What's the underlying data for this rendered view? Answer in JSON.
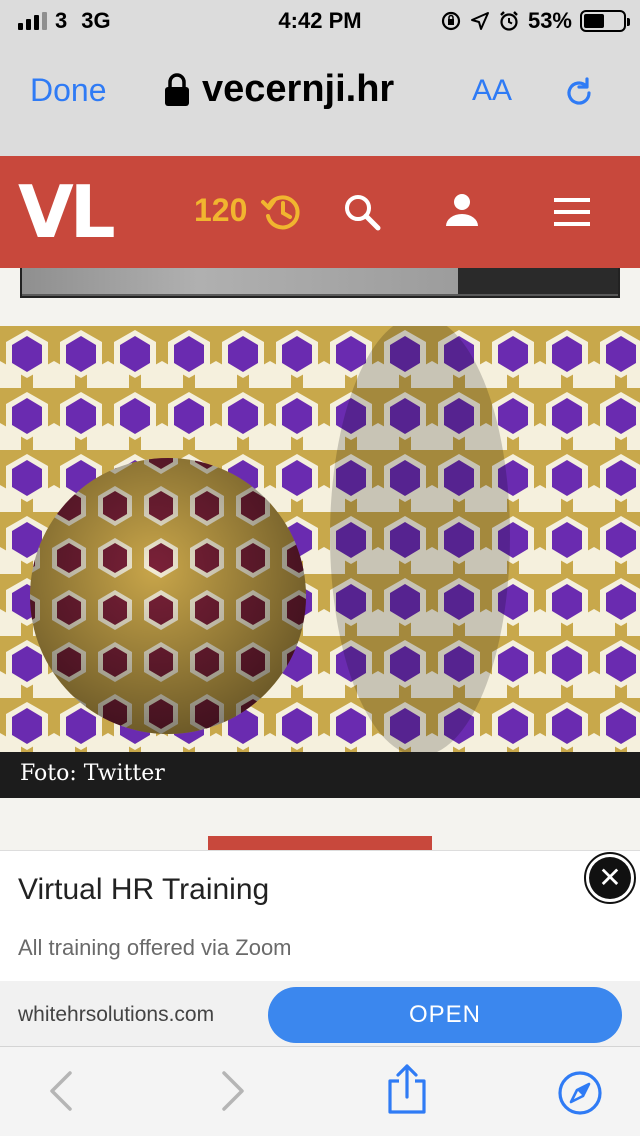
{
  "status_bar": {
    "carrier": "3",
    "network": "3G",
    "time": "4:42 PM",
    "battery": "53%",
    "battery_level": 0.53
  },
  "browser": {
    "done_label": "Done",
    "domain": "vecernji.hr",
    "text_size_label": "AA"
  },
  "site_header": {
    "logo": "VL",
    "history_count": "120",
    "accent": "#c8483c",
    "count_color": "#f1b52f"
  },
  "article": {
    "photo_caption": "Foto: Twitter"
  },
  "ad": {
    "title": "Virtual HR Training",
    "subtitle": "All training offered via Zoom",
    "url": "whitehrsolutions.com",
    "cta": "OPEN",
    "cta_color": "#3b87ee"
  },
  "icons": {
    "history": "history-icon",
    "search": "search-icon",
    "user": "user-icon",
    "menu": "menu-icon",
    "back": "back-icon",
    "forward": "forward-icon",
    "share": "share-icon",
    "compass": "compass-icon",
    "lock": "lock-icon",
    "reload": "reload-icon"
  }
}
